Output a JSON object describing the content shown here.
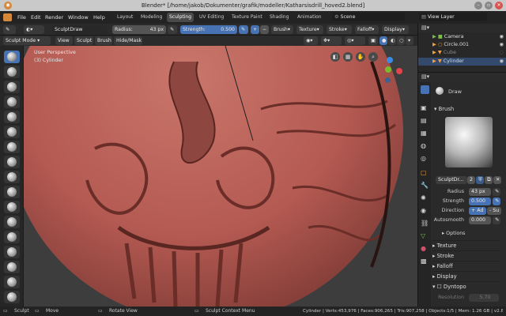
{
  "window": {
    "title": "Blender* [/home/jakob/Dokumenter/grafik/modeller/Katharsisdrill_hoved2.blend]"
  },
  "menu": {
    "items": [
      "File",
      "Edit",
      "Render",
      "Window",
      "Help"
    ]
  },
  "workspaces": {
    "tabs": [
      "Layout",
      "Modeling",
      "Sculpting",
      "UV Editing",
      "Texture Paint",
      "Shading",
      "Animation"
    ],
    "active": "Sculpting"
  },
  "scene": {
    "label": "Scene",
    "view_layer": "View Layer"
  },
  "tool_header": {
    "brush_name": "SculptDraw",
    "radius_label": "Radius:",
    "radius_value": "43 px",
    "strength_label": "Strength:",
    "strength_value": "0.500",
    "menus": [
      "Brush",
      "Texture",
      "Stroke",
      "Falloff",
      "Display"
    ]
  },
  "mode_header": {
    "mode": "Sculpt Mode",
    "menus": [
      "View",
      "Sculpt",
      "Brush",
      "Hide/Mask"
    ]
  },
  "viewport": {
    "perspective": "User Perspective",
    "object": "(3) Cylinder"
  },
  "outliner": {
    "items": [
      "Camera",
      "Circle.001",
      "Cube",
      "Cylinder"
    ],
    "selected": "Cylinder"
  },
  "properties": {
    "tool_name": "Draw",
    "brush_panel": "Brush",
    "brush_name": "SculptDr...",
    "brush_users": "2",
    "radius_label": "Radius",
    "radius_value": "43 px",
    "strength_label": "Strength",
    "strength_value": "0.500",
    "direction_label": "Direction",
    "direction_add": "+ Ad",
    "direction_sub": "- Su",
    "autosmooth_label": "Autosmooth",
    "autosmooth_value": "0.000",
    "options": "Options",
    "panels": [
      "Texture",
      "Stroke",
      "Falloff",
      "Display",
      "Dyntopo"
    ],
    "resolution_label": "Resolution",
    "resolution_value": "5.70"
  },
  "statusbar": {
    "items": [
      "Sculpt",
      "Move",
      "Rotate View",
      "Sculpt Context Menu"
    ],
    "stats": "Cylinder | Verts:453,976 | Faces:906,265 | Tris:907,258 | Objects:1/5 | Mem: 1.26 GB | v2.80"
  },
  "colors": {
    "accent": "#4772b3",
    "sculpt": "#b45a52",
    "viewport_bg": "#3d3d3d"
  }
}
